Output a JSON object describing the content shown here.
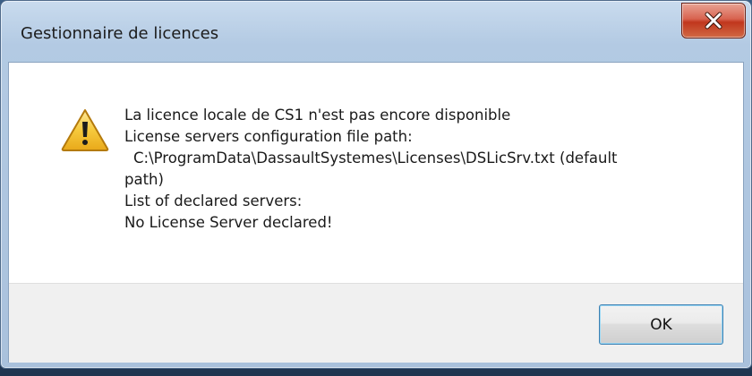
{
  "window": {
    "title": "Gestionnaire de licences"
  },
  "titlebar": {
    "close_icon": "close-icon"
  },
  "dialog": {
    "icon": "warning-icon",
    "message_lines": [
      "La licence locale de CS1 n'est pas encore disponible",
      "License servers configuration file path:",
      "C:\\ProgramData\\DassaultSystemes\\Licenses\\DSLicSrv.txt (default",
      "path)",
      "List of declared servers:",
      "No License Server declared!"
    ]
  },
  "buttons": {
    "ok_label": "OK"
  },
  "colors": {
    "close_button": "#c9452c",
    "ok_border": "#3c7fb1",
    "warning_fill": "#f5c531"
  }
}
